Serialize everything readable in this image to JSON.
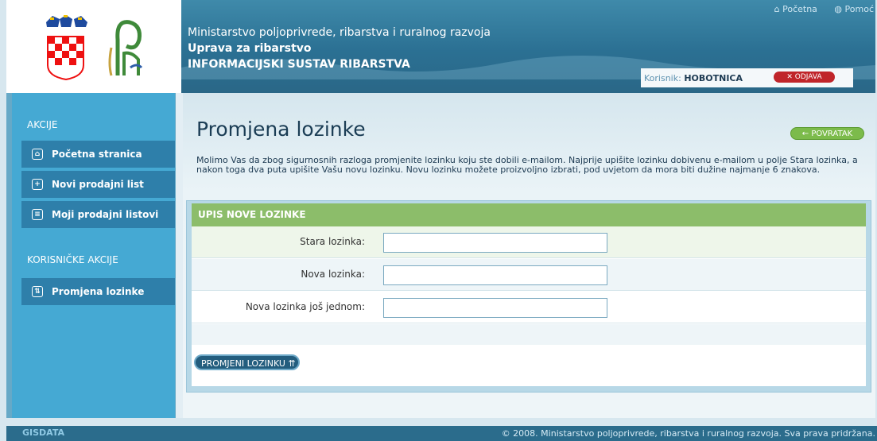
{
  "header": {
    "line1": "Ministarstvo poljoprivrede, ribarstva i ruralnog razvoja",
    "line2": "Uprava za ribarstvo",
    "line3": "INFORMACIJSKI SUSTAV RIBARSTVA",
    "links": [
      "Početna",
      "Pomoć"
    ],
    "user_label": "Korisnik:",
    "user_name": "HOBOTNICA",
    "logout": "✕ ODJAVA"
  },
  "sidebar": {
    "section1": "AKCIJE",
    "items": [
      {
        "label": "Početna stranica",
        "icon": "home-icon"
      },
      {
        "label": "Novi prodajni list",
        "icon": "new-doc-icon"
      },
      {
        "label": "Moji prodajni listovi",
        "icon": "list-doc-icon"
      }
    ],
    "section2": "KORISNIČKE AKCIJE",
    "items2": [
      {
        "label": "Promjena lozinke",
        "icon": "password-icon"
      }
    ]
  },
  "main": {
    "title": "Promjena lozinke",
    "back": "← POVRATAK",
    "description": "Molimo Vas da zbog sigurnosnih razloga promjenite lozinku koju ste dobili e-mailom. Najprije upišite lozinku dobivenu e-mailom u polje Stara lozinka, a nakon toga dva puta upišite Vašu novu lozinku. Novu lozinku možete proizvoljno izbrati, pod uvjetom da mora biti dužine najmanje 6 znakova.",
    "panel_title": "UPIS NOVE LOZINKE",
    "fields": [
      {
        "label": "Stara lozinka:",
        "value": ""
      },
      {
        "label": "Nova lozinka:",
        "value": ""
      },
      {
        "label": "Nova lozinka još jednom:",
        "value": ""
      }
    ],
    "submit": "PROMJENI LOZINKU ⇈"
  },
  "footer": {
    "brand": "GISDATA",
    "copyright": "© 2008. Ministarstvo poljoprivrede, ribarstva i ruralnog razvoja. Sva prava pridržana."
  }
}
